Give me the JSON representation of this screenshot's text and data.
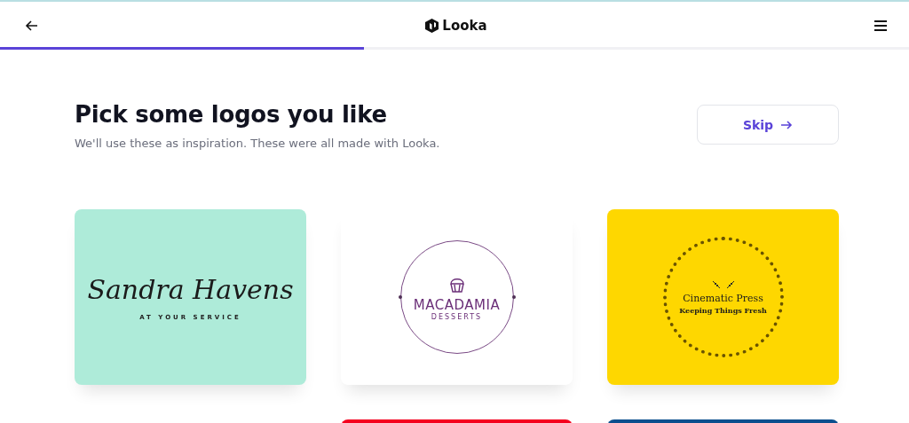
{
  "header": {
    "brand": "Looka",
    "progress": {
      "level": 0.4
    }
  },
  "heading": {
    "title": "Pick some logos you like",
    "subtitle": "We'll use these as inspiration. These were all made with Looka.",
    "skip": "Skip"
  },
  "columns": [
    [
      {
        "kind": "script",
        "color": "#aeebd9",
        "name": "Sandra Havens",
        "tagline": "AT YOUR SERVICE"
      }
    ],
    [
      {
        "kind": "badge",
        "color": "#ffffff",
        "name": "MACADAMIA",
        "tagline": "DESSERTS"
      },
      {
        "kind": "blank",
        "color": "#f5001e"
      }
    ],
    [
      {
        "kind": "stamp",
        "color": "#fed700",
        "name": "Cinematic Press",
        "tagline": "Keeping Things Fresh"
      },
      {
        "kind": "blank",
        "color": "#0a4f8e"
      }
    ]
  ]
}
